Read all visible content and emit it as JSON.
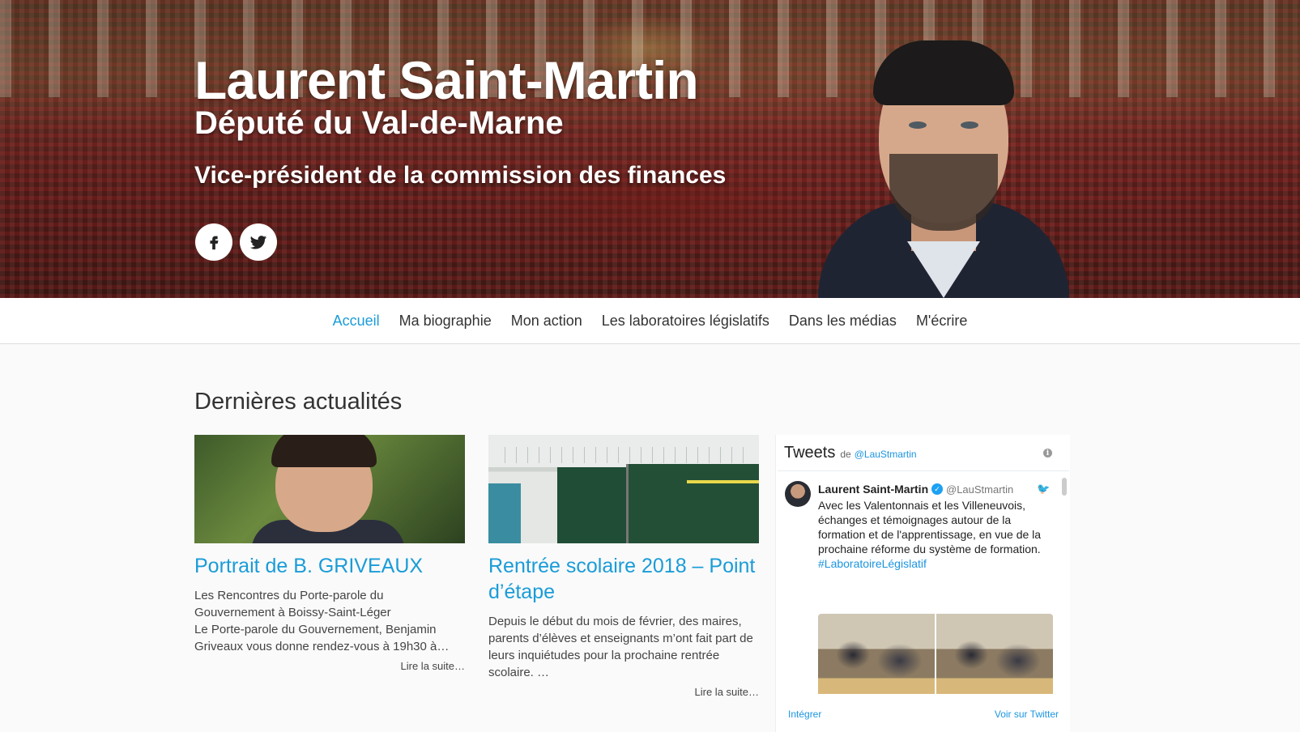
{
  "hero": {
    "name": "Laurent Saint-Martin",
    "subtitle": "Député du Val-de-Marne",
    "role": "Vice-président de la commission des finances",
    "social": [
      "facebook-icon",
      "twitter-icon"
    ]
  },
  "nav": {
    "items": [
      {
        "label": "Accueil",
        "active": true
      },
      {
        "label": "Ma biographie"
      },
      {
        "label": "Mon action"
      },
      {
        "label": "Les laboratoires législatifs"
      },
      {
        "label": "Dans les médias"
      },
      {
        "label": "M'écrire"
      }
    ],
    "active_color": "#1a9cd8"
  },
  "news": {
    "title": "Dernières actualités",
    "articles": [
      {
        "title": "Portrait de B. GRIVEAUX",
        "excerpt": "Les Rencontres du Porte-parole du Gouvernement à Boissy-Saint-Léger\nLe Porte-parole du Gouvernement, Benjamin Griveaux vous donne rendez-vous à 19h30 à…",
        "more": "Lire la suite…"
      },
      {
        "title": "Rentrée scolaire 2018 – Point d’étape",
        "excerpt": "Depuis le début du mois de février, des maires, parents d’élèves et enseignants m’ont fait part de leurs inquiétudes pour la prochaine rentrée scolaire. …",
        "more": "Lire la suite…"
      }
    ]
  },
  "tweets": {
    "title": "Tweets",
    "by": "de",
    "handle": "@LauStmartin",
    "tweet": {
      "name": "Laurent Saint-Martin",
      "user": "@LauStmartin",
      "text": "Avec les Valentonnais et les Villeneuvois, échanges et témoignages autour de la formation et de l'apprentissage, en vue de la prochaine réforme du système de formation.",
      "hashtag": "#LaboratoireLégislatif"
    },
    "embed": "Intégrer",
    "view": "Voir sur Twitter"
  }
}
